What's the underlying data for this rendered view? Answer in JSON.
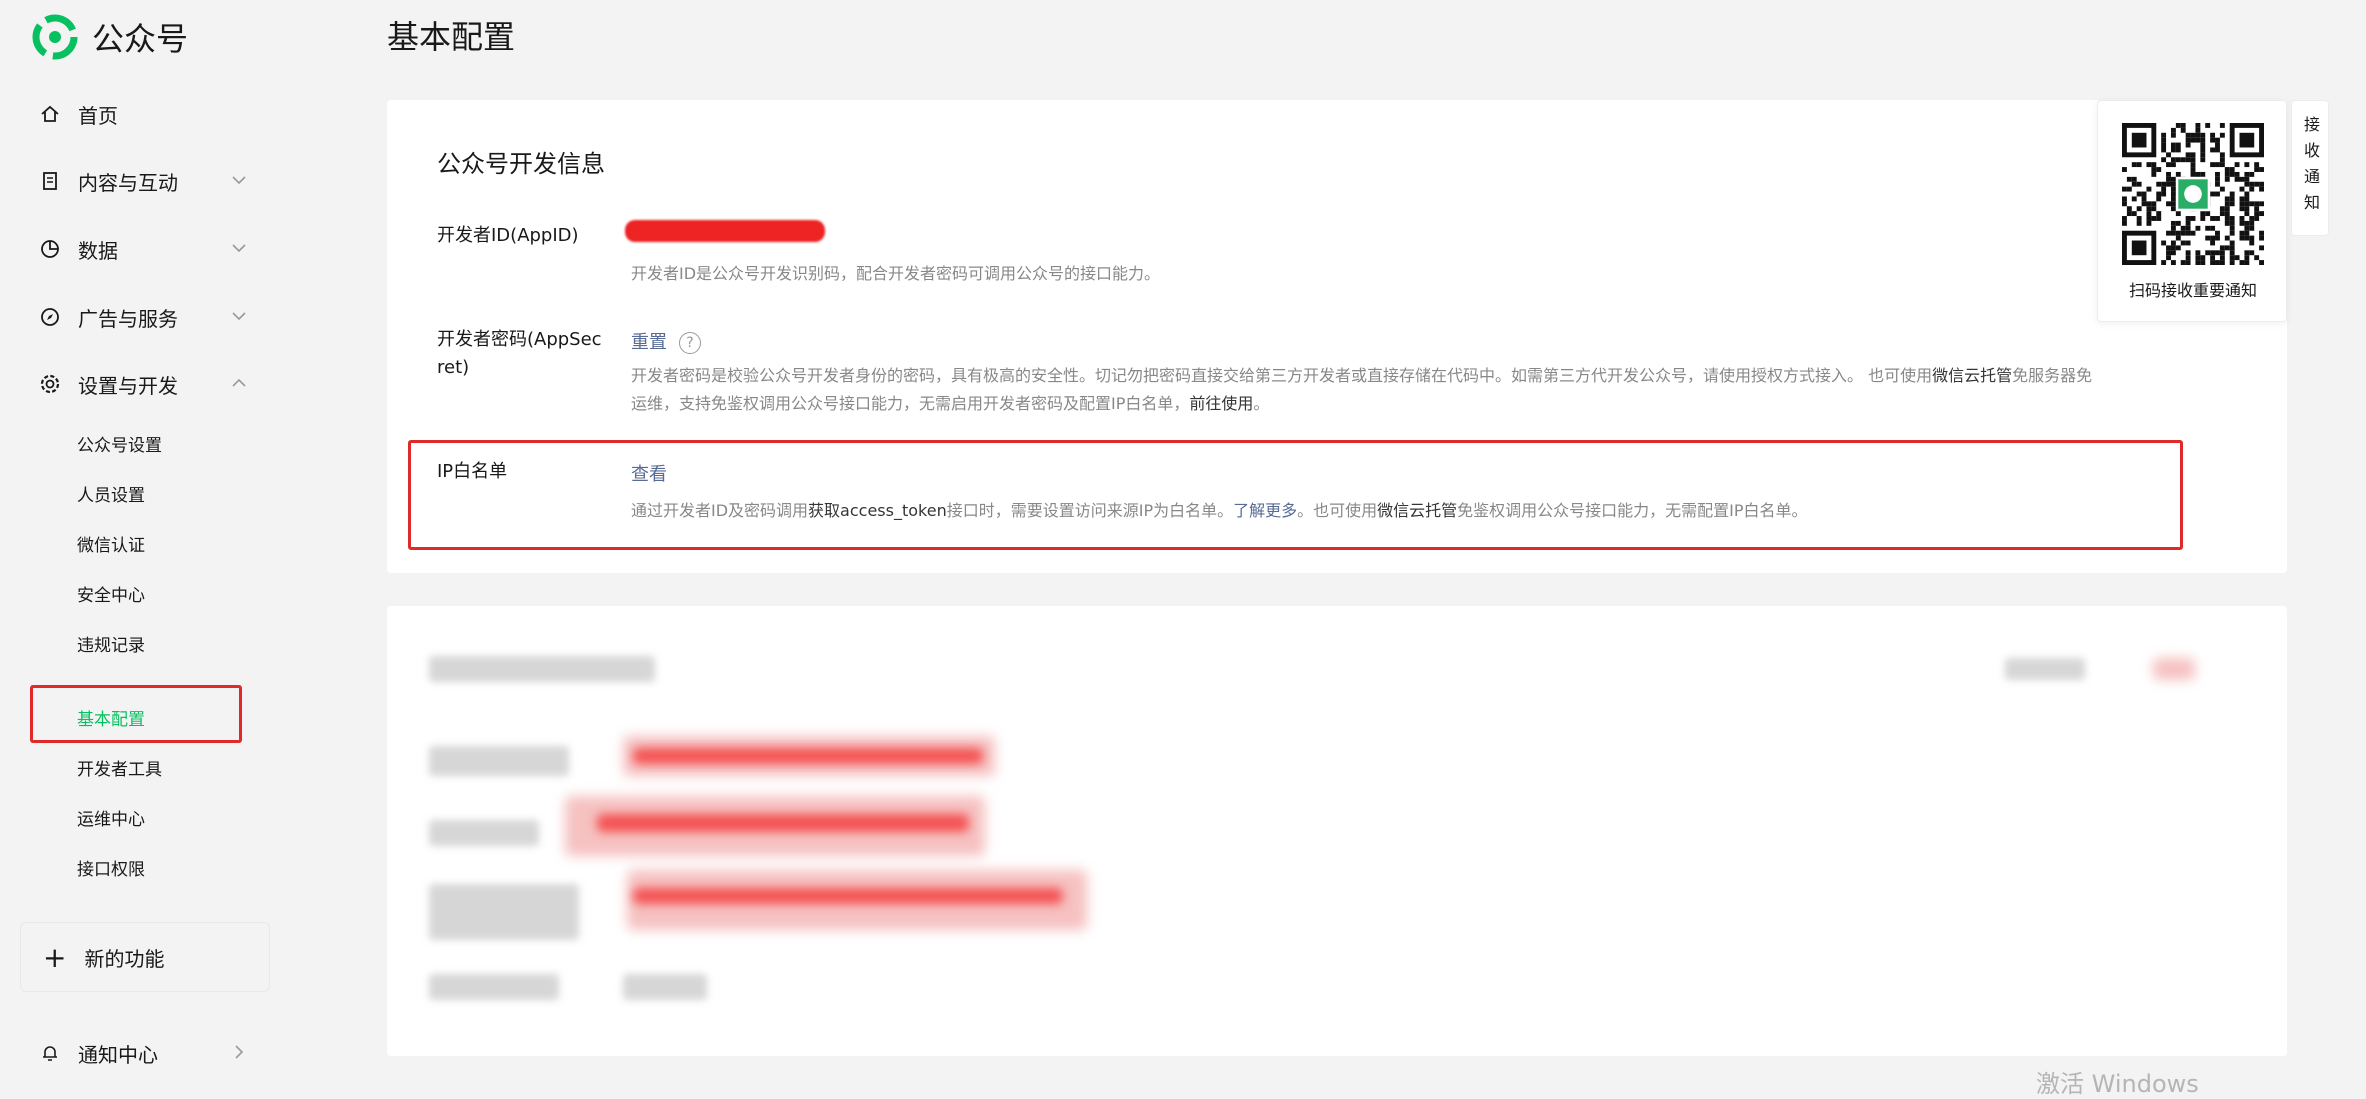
{
  "app": {
    "title": "公众号"
  },
  "page": {
    "title": "基本配置"
  },
  "sidebar": {
    "home": "首页",
    "content": "内容与互动",
    "data": "数据",
    "ads": "广告与服务",
    "settings": "设置与开发",
    "sub_items": [
      "公众号设置",
      "人员设置",
      "微信认证",
      "安全中心",
      "违规记录",
      "基本配置",
      "开发者工具",
      "运维中心",
      "接口权限"
    ],
    "new_features": "新的功能",
    "notifications": "通知中心"
  },
  "dev_info": {
    "title": "公众号开发信息",
    "appid_label": "开发者ID(AppID)",
    "appid_desc": "开发者ID是公众号开发识别码，配合开发者密码可调用公众号的接口能力。",
    "secret_label_1": "开发者密码(AppSec",
    "secret_label_2": "ret)",
    "secret_action": "重置",
    "secret_desc_1a": "开发者密码是校验公众号开发者身份的密码，具有极高的安全性。切记勿把密码直接交给第三方开发者或直接存储在代码中。如需第三方代开发公众号，请使用授权方式接入。 也可使用",
    "secret_desc_1b": "微信云托管",
    "secret_desc_1c": "免服务器免",
    "secret_desc_2a": "运维，支持免鉴权调用公众号接口能力，无需启用开发者密码及配置IP白名单，",
    "secret_desc_2b": "前往使用",
    "secret_desc_2c": "。",
    "ip_label": "IP白名单",
    "ip_action": "查看",
    "ip_desc_a": "通过开发者ID及密码调用",
    "ip_desc_b": "获取access_token",
    "ip_desc_c": "接口时，需要设置访问来源IP为白名单。",
    "ip_desc_d": "了解更多",
    "ip_desc_e": "。也可使用",
    "ip_desc_f": "微信云托管",
    "ip_desc_g": "免鉴权调用公众号接口能力，无需配置IP白名单。"
  },
  "qr": {
    "caption": "扫码接收重要通知"
  },
  "notify_tab": "接收通知",
  "watermark": "激活 Windows",
  "colors": {
    "brand": "#07c160",
    "link": "#576b95",
    "highlight": "#e02a2a"
  }
}
